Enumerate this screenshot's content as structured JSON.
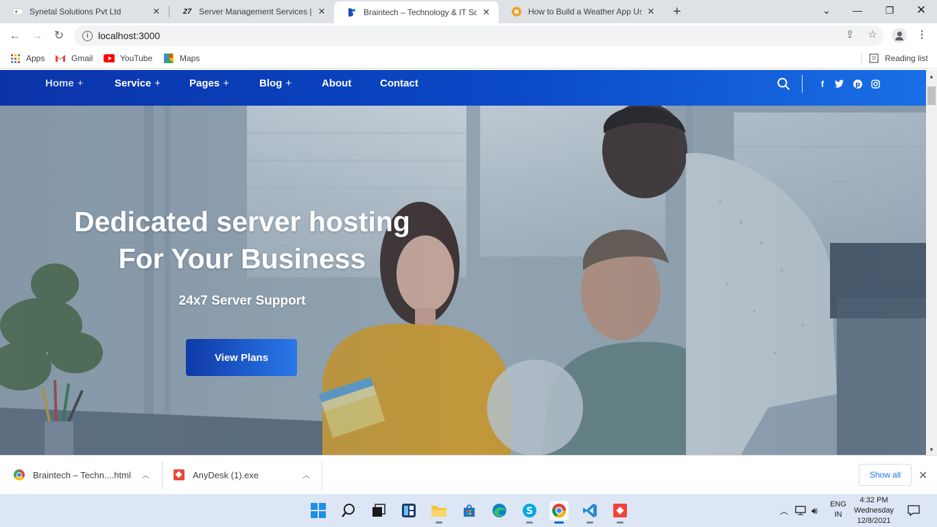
{
  "browser": {
    "tabs": [
      {
        "title": "Synetal Solutions Pvt Ltd",
        "favicon": "synetal-logo"
      },
      {
        "title": "Server Management Services | Se",
        "favicon": "27-logo"
      },
      {
        "title": "Braintech – Technology & IT Solu",
        "favicon": "braintech-logo",
        "active": true
      },
      {
        "title": "How to Build a Weather App Usin",
        "favicon": "weather-app-logo"
      }
    ],
    "url": "localhost:3000",
    "bookmarks": [
      {
        "label": "Apps",
        "icon": "apps-grid-icon"
      },
      {
        "label": "Gmail",
        "icon": "gmail-icon"
      },
      {
        "label": "YouTube",
        "icon": "youtube-icon"
      },
      {
        "label": "Maps",
        "icon": "maps-icon"
      }
    ],
    "reading_list": "Reading list"
  },
  "site": {
    "nav": [
      {
        "label": "Home",
        "plus": "+"
      },
      {
        "label": "Service",
        "plus": "+"
      },
      {
        "label": "Pages",
        "plus": "+"
      },
      {
        "label": "Blog",
        "plus": "+"
      },
      {
        "label": "About",
        "plus": ""
      },
      {
        "label": "Contact",
        "plus": ""
      }
    ],
    "social": [
      "facebook-icon",
      "twitter-icon",
      "pinterest-icon",
      "instagram-icon"
    ],
    "colors": {
      "nav_start": "#0b33a8",
      "nav_end": "#1a6fe6",
      "button_start": "#0f3aa8",
      "button_end": "#2a77e8"
    }
  },
  "hero": {
    "heading_line1": "Dedicated server hosting",
    "heading_line2": "For Your Business",
    "subheading": "24x7 Server Support",
    "button": "View Plans"
  },
  "downloads": {
    "items": [
      {
        "name": "Braintech – Techn....html",
        "icon": "chrome-icon"
      },
      {
        "name": "AnyDesk (1).exe",
        "icon": "anydesk-icon"
      }
    ],
    "show_all": "Show all"
  },
  "taskbar": {
    "lang_line1": "ENG",
    "lang_line2": "IN",
    "time": "4:32 PM",
    "day": "Wednesday",
    "date": "12/8/2021"
  }
}
